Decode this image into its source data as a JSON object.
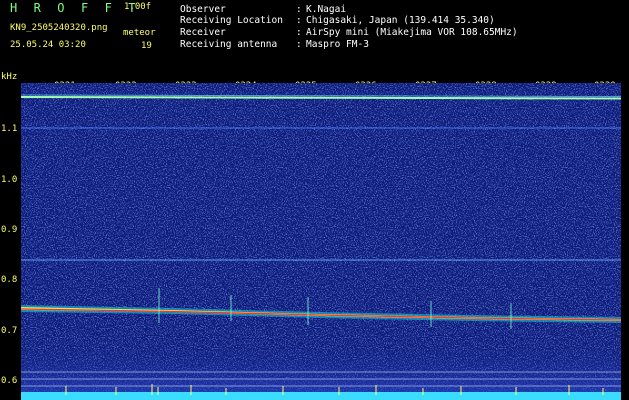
{
  "header": {
    "title": "H R O F F T",
    "version": "1.00f",
    "filename": "KN9_2505240320.png",
    "meteor_label": "meteor",
    "datetime": "25.05.24 03:20",
    "meteor_count": "19"
  },
  "meta": [
    {
      "label": "Observer",
      "value": "K.Nagai"
    },
    {
      "label": "Receiving Location",
      "value": "Chigasaki, Japan (139.414 35.340)"
    },
    {
      "label": "Receiver",
      "value": "AirSpy mini (Miakejima VOR 108.65MHz)"
    },
    {
      "label": "Receiving antenna",
      "value": "Maspro FM-3"
    }
  ],
  "axis": {
    "unit": "kHz",
    "y_labels": [
      "1.1",
      "1.0",
      "0.9",
      "0.8",
      "0.7",
      "0.6"
    ],
    "y_values": [
      1.1,
      1.0,
      0.9,
      0.8,
      0.7,
      0.6
    ],
    "time_labels": [
      "0321",
      "0322",
      "0323",
      "0324",
      "0325",
      "0326",
      "0327",
      "0328",
      "0329",
      "0330"
    ],
    "y_top": 1.16,
    "y_bottom": 0.59
  },
  "colors": {
    "background": "#000000",
    "spectrogram": "#0a1a7a",
    "carrier": "#9fffb0",
    "echo_line": "#ff3030",
    "label_yellow": "#ffff66",
    "title_green": "#7dff7d"
  }
}
